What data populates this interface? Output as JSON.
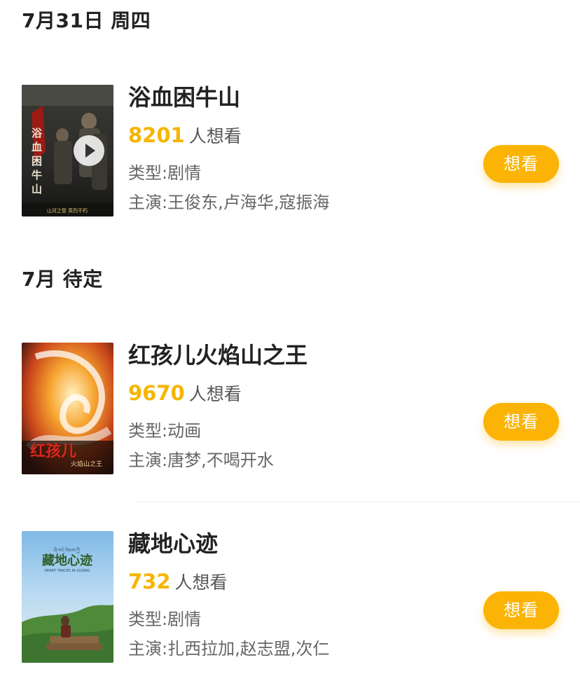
{
  "sections": [
    {
      "header": "7月31日 周四",
      "movies": [
        {
          "title": "浴血困牛山",
          "want_count": "8201",
          "want_suffix": "人想看",
          "genre": "类型:剧情",
          "cast": "主演:王俊东,卢海华,寇振海",
          "button": "想看",
          "has_trailer": true
        }
      ]
    },
    {
      "header": "7月 待定",
      "movies": [
        {
          "title": "红孩儿火焰山之王",
          "want_count": "9670",
          "want_suffix": "人想看",
          "genre": "类型:动画",
          "cast": "主演:唐梦,不喝开水",
          "button": "想看",
          "has_trailer": false
        },
        {
          "title": "藏地心迹",
          "want_count": "732",
          "want_suffix": "人想看",
          "genre": "类型:剧情",
          "cast": "主演:扎西拉加,赵志盟,次仁",
          "button": "想看",
          "has_trailer": false
        }
      ]
    }
  ],
  "posters": {
    "poster_1": {
      "title_text": "浴血困牛山",
      "tagline": "山河之誓  英烈不朽"
    },
    "poster_2": {
      "title_text": "红孩儿",
      "subtitle": "火焰山之王"
    },
    "poster_3": {
      "title_text": "藏地心迹",
      "subtitle": "HEART TRACES IN XIZANG"
    }
  },
  "colors": {
    "accent": "#fbb406",
    "want_count": "#f7b500",
    "title": "#222222",
    "secondary_text": "#666666"
  }
}
